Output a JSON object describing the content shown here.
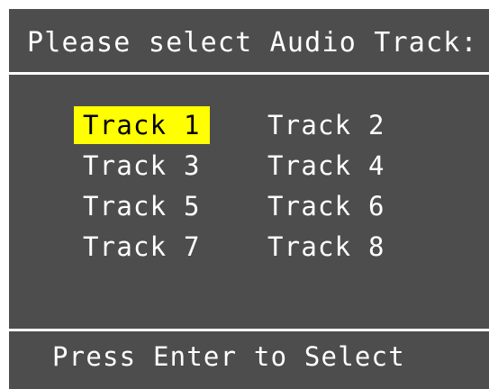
{
  "dialog": {
    "title": "Please select Audio Track:",
    "footer": "Press Enter to Select",
    "selected_index": 0,
    "highlight_color": "#ffff00",
    "background_color": "#4d4d4d",
    "text_color": "#ffffff",
    "tracks": [
      {
        "label": "Track 1"
      },
      {
        "label": "Track 2"
      },
      {
        "label": "Track 3"
      },
      {
        "label": "Track 4"
      },
      {
        "label": "Track 5"
      },
      {
        "label": "Track 6"
      },
      {
        "label": "Track 7"
      },
      {
        "label": "Track 8"
      }
    ]
  }
}
